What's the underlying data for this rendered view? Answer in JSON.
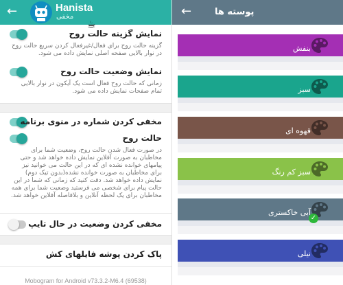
{
  "left_panel": {
    "app_name": "Hanista",
    "app_subtitle": "مخفی",
    "settings": [
      {
        "title": "نمایش گزینه حالت روح",
        "description": "گزینه حالت روح برای فعال/غیرفعال کردن سریع حالت روح در نوار بالایی صفحه اصلی نمایش داده می شود.",
        "switch_on": true
      },
      {
        "title": "نمایش وضعیت حالت روح",
        "description": "زمانی که حالت روح فعال است یک آیکون در نوار بالایی تمام صفحات نمایش داده می شود.",
        "switch_on": true
      },
      {
        "title": "مخفی کردن شماره در منوی برنامه",
        "description": "",
        "switch_on": true
      },
      {
        "title": "حالت روح",
        "description": "در صورت فعال شدن حالت روح، وضعیت شما برای مخاطبان به صورت آفلاین نمایش داده خواهد شد و حتی پیامهای خوانده نشده ای که در این حالت می خوانید نیز برای مخاطبان به صورت خوانده نشده(بدون تیک دوم) نمایش داده خواهد شد. دقت کنید که زمانی که شما در این حالت پیام برای شخصی می فرستید وضعیت شما برای همه مخاطبان برای یک لحظه آنلاین و بلافاصله آفلاین خواهد شد.",
        "switch_on": true
      },
      {
        "title": "مخفی کردن وضعیت در حال تایپ",
        "description": "",
        "switch_on": false
      },
      {
        "title": "پاک کردن پوشه فایلهای کش",
        "description": ""
      }
    ],
    "footer": "Mobogram for Android v73.3.2-M6.4 (69538)"
  },
  "right_panel": {
    "title": "پوسته ها",
    "themes": [
      {
        "label": "بنفش",
        "color": "#a42fb4",
        "strip": "#e6e8ee",
        "selected": false
      },
      {
        "label": "سبز",
        "color": "#1aa58d",
        "strip": "#e6e8ee",
        "selected": false
      },
      {
        "label": "قهوه ای",
        "color": "#795549",
        "strip": "#e6e8ee",
        "selected": false
      },
      {
        "label": "سبز کم رنگ",
        "color": "#8ac249",
        "strip": "#e6e8ee",
        "selected": false
      },
      {
        "label": "آبی خاکستری",
        "color": "#5f7888",
        "strip": "#e6e8ee",
        "selected": true
      },
      {
        "label": "نیلی",
        "color": "#3f51b5",
        "strip": "#e6e8ee",
        "selected": false
      }
    ]
  }
}
